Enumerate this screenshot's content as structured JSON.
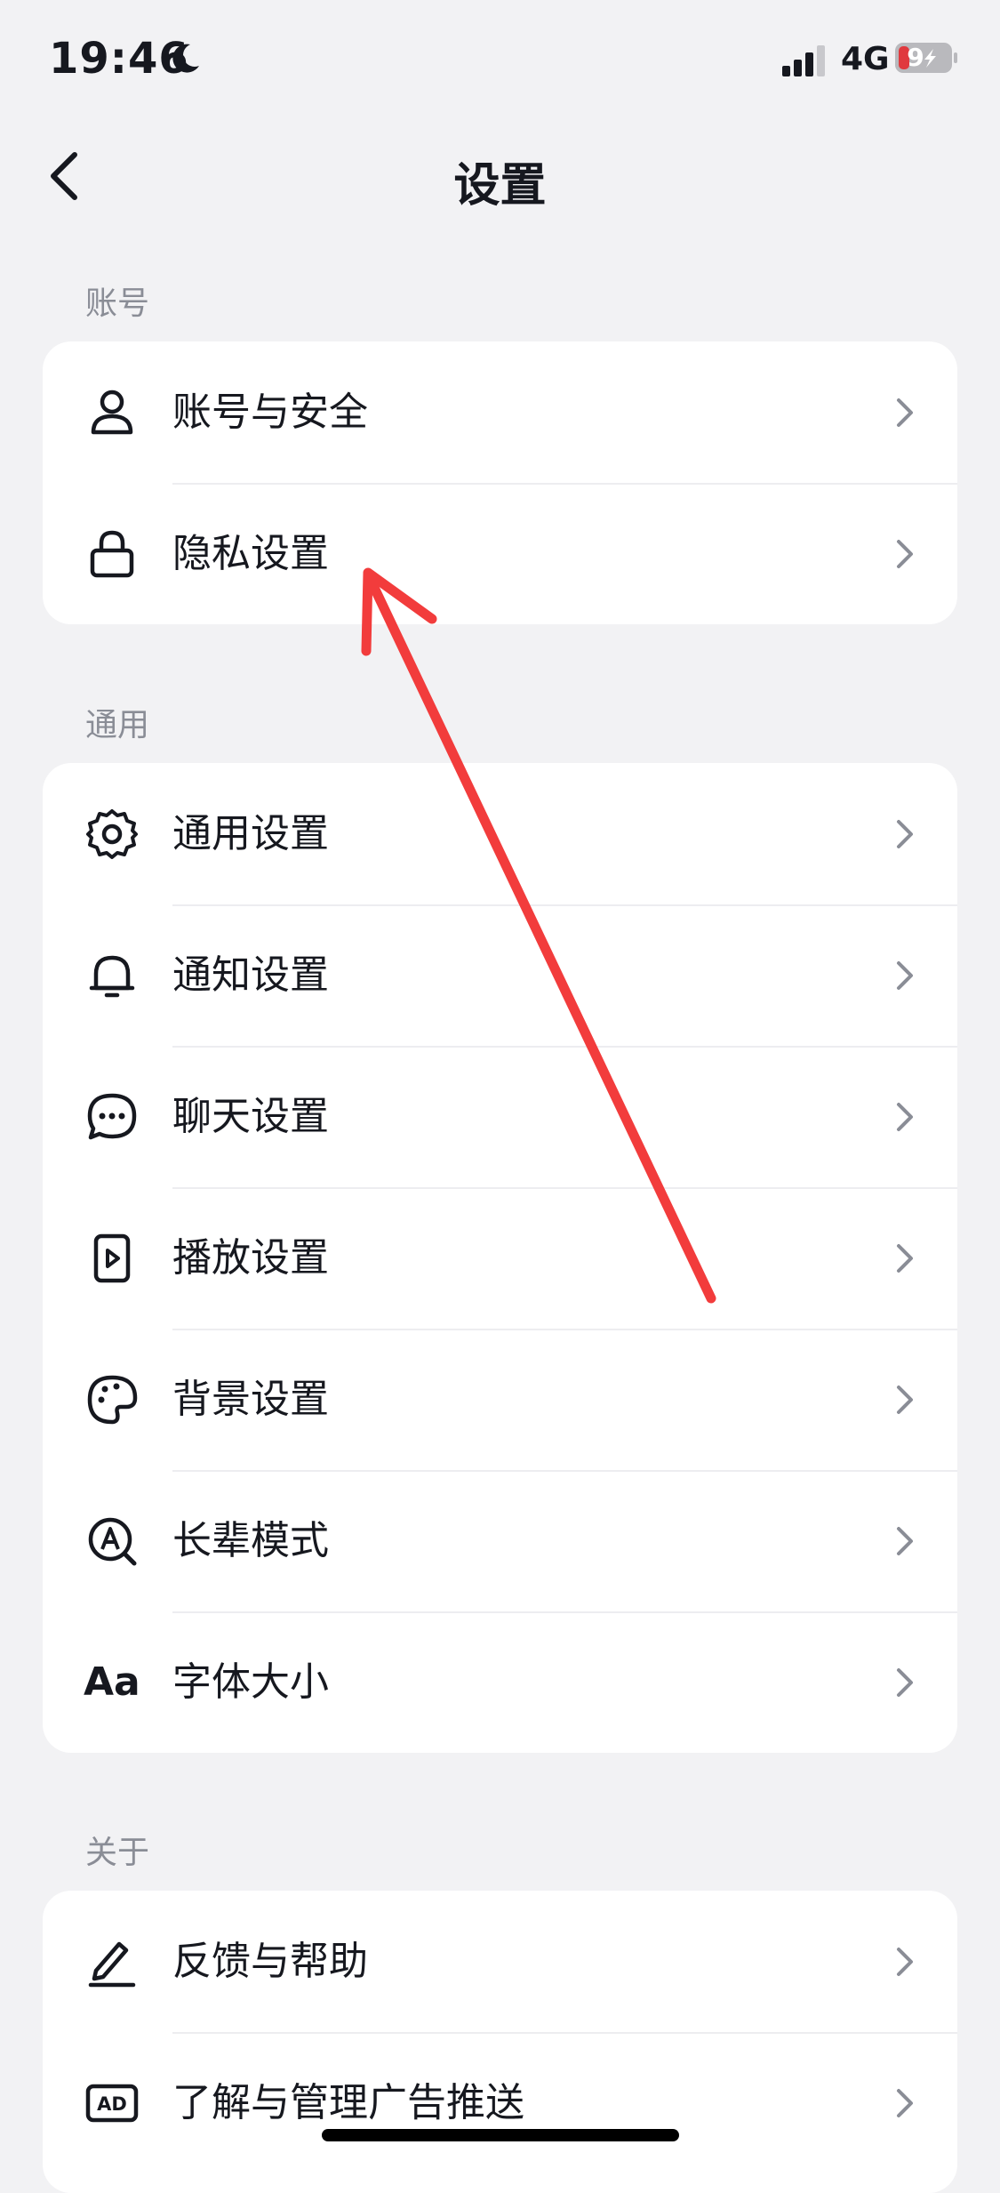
{
  "status_bar": {
    "time": "19:46",
    "network": "4G",
    "battery": "9"
  },
  "header": {
    "title": "设置"
  },
  "sections": [
    {
      "label": "账号",
      "items": [
        {
          "label": "账号与安全",
          "icon": "person-icon"
        },
        {
          "label": "隐私设置",
          "icon": "lock-icon"
        }
      ]
    },
    {
      "label": "通用",
      "items": [
        {
          "label": "通用设置",
          "icon": "gear-icon"
        },
        {
          "label": "通知设置",
          "icon": "bell-icon"
        },
        {
          "label": "聊天设置",
          "icon": "chat-bubble-icon"
        },
        {
          "label": "播放设置",
          "icon": "play-icon"
        },
        {
          "label": "背景设置",
          "icon": "palette-icon"
        },
        {
          "label": "长辈模式",
          "icon": "elder-mode-icon"
        },
        {
          "label": "字体大小",
          "icon": "font-size-icon",
          "icon_text": "Aa"
        }
      ]
    },
    {
      "label": "关于",
      "items": [
        {
          "label": "反馈与帮助",
          "icon": "edit-icon"
        },
        {
          "label": "了解与管理广告推送",
          "icon": "ad-icon",
          "icon_text": "AD"
        }
      ]
    }
  ],
  "colors": {
    "background": "#f2f2f4",
    "card": "#ffffff",
    "annotation_arrow": "#f23c3c",
    "battery_low": "#e0393e"
  }
}
